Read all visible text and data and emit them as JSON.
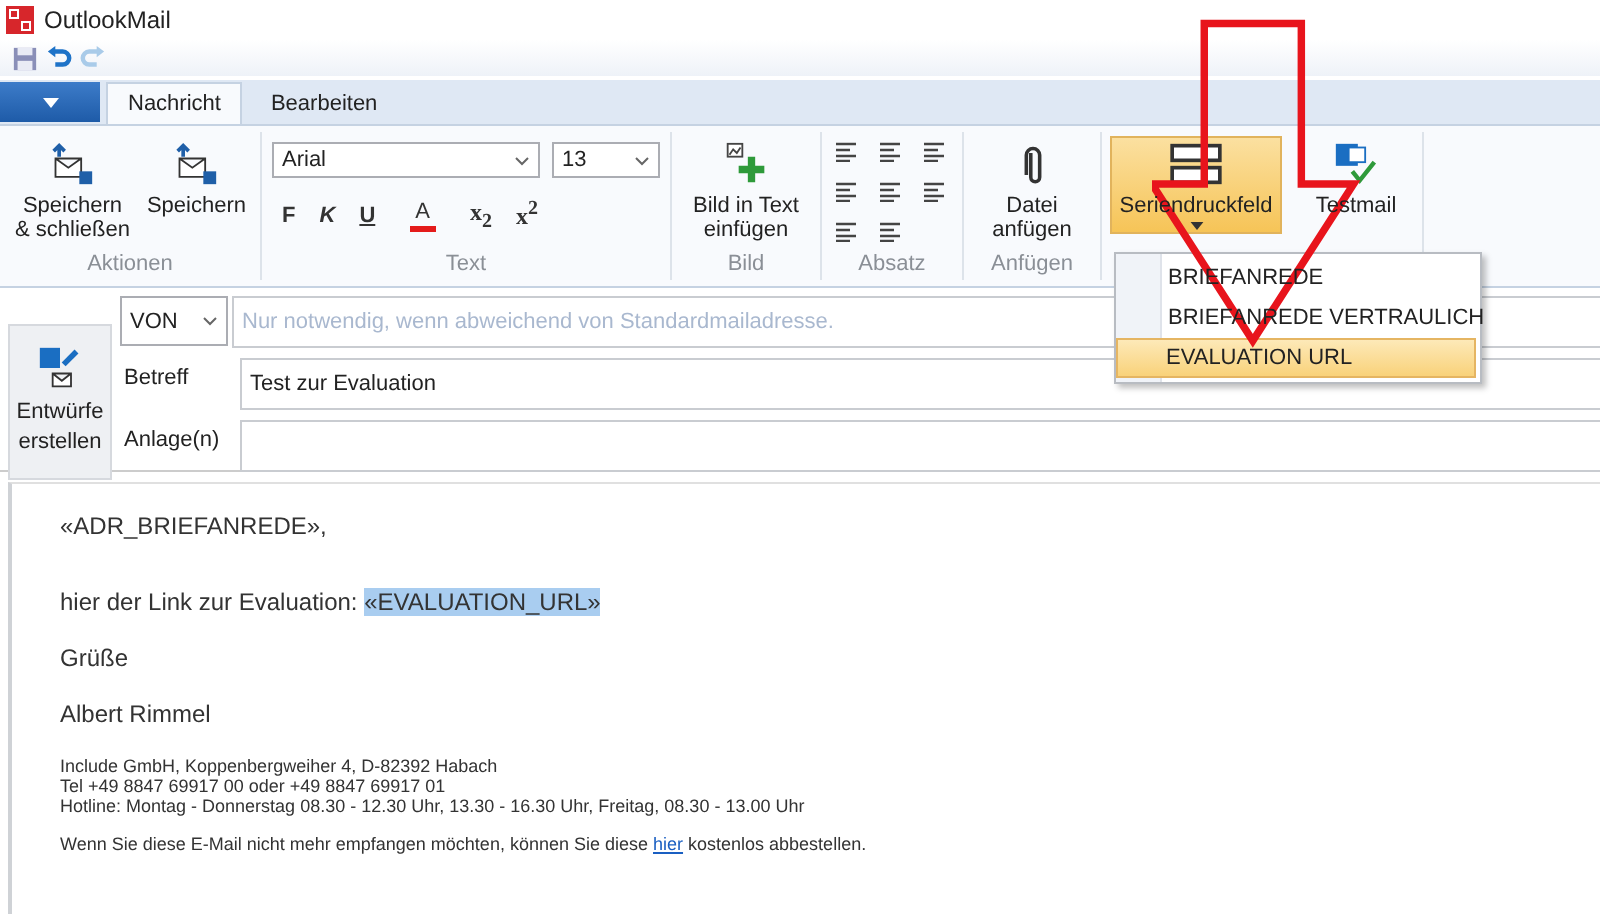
{
  "window": {
    "title": "OutlookMail"
  },
  "tabs": [
    {
      "label": "Nachricht",
      "selected": true
    },
    {
      "label": "Bearbeiten",
      "selected": false
    }
  ],
  "actions": {
    "label": "Aktionen",
    "buttons": [
      "Speichern & schließen",
      "Speichern"
    ]
  },
  "text_group": {
    "label": "Text",
    "font": "Arial",
    "size": "13",
    "format_buttons": [
      {
        "kind": "bold",
        "label": "F"
      },
      {
        "kind": "italic",
        "label": "K"
      },
      {
        "kind": "underline",
        "label": "U"
      },
      {
        "kind": "color",
        "label": "A"
      },
      {
        "kind": "sub",
        "label": "x$_{2}$"
      },
      {
        "kind": "sup",
        "label": "x$^{2}$"
      }
    ]
  },
  "image_group": {
    "label": "Bild",
    "button": "Bild in Text einfügen"
  },
  "paragraph_group": {
    "label": "Absatz"
  },
  "attach_group": {
    "label": "Anfügen",
    "button": "Datei anfügen"
  },
  "merge_field": {
    "button": "Seriendruckfeld",
    "menu": [
      {
        "label": "BRIEFANREDE",
        "selected": false
      },
      {
        "label": "BRIEFANREDE VERTRAULICH",
        "selected": false
      },
      {
        "label": "EVALUATION URL",
        "selected": true
      }
    ]
  },
  "testmail": {
    "button": "Testmail"
  },
  "header": {
    "drafts_button": "Entwürfe erstellen",
    "from": {
      "value": "VON",
      "placeholder": "Nur notwendig, wenn abweichend von Standardmailadresse."
    },
    "subject": {
      "label": "Betreff",
      "value": "Test zur Evaluation"
    },
    "attachments": {
      "label": "Anlage(n)"
    }
  },
  "body": {
    "salutation": "«ADR_BRIEFANREDE»,",
    "link_text": "hier der Link zur Evaluation:",
    "link_field": "«EVALUATION_URL»",
    "greeting": "Grüße",
    "name": "Albert Rimmel",
    "signature": [
      "Include GmbH, Koppenbergweiher 4, D-82392 Habach",
      "Tel +49 8847 69917 00 oder +49 8847 69917 01",
      "Hotline: Montag - Donnerstag 08.30 - 12.30 Uhr, 13.30 - 16.30 Uhr, Freitag, 08.30 - 13.00 Uhr"
    ],
    "unsubscribe": {
      "before": "Wenn Sie diese E-Mail nicht mehr empfangen möchten, können Sie diese",
      "link": "hier",
      "after": "kostenlos abbestellen."
    }
  }
}
